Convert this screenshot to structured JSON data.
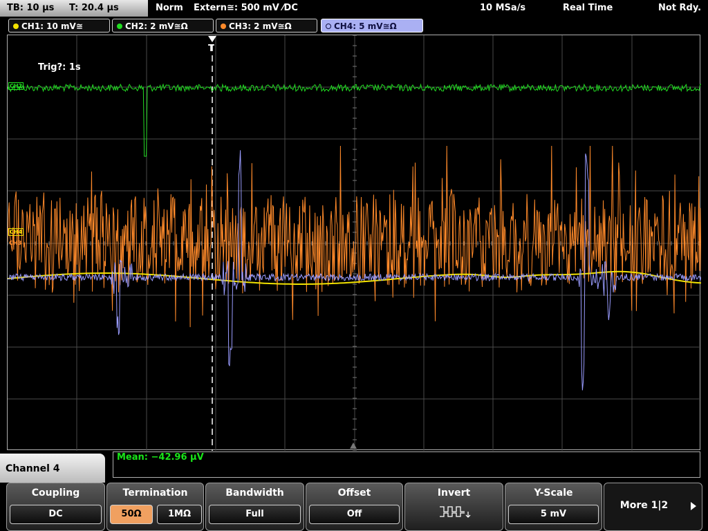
{
  "top": {
    "timebase": "TB: 10 µs",
    "trigger_time": "T: 20.4 µs",
    "trigger_mode": "Norm",
    "trigger_source": "Extern≅: 500 mV ⁄DC",
    "sample_rate": "10 MSa/s",
    "acq_mode": "Real Time",
    "status": "Not Rdy."
  },
  "channels": [
    {
      "label": "CH1: 10 mV≅",
      "color": "#f2e200",
      "active": false
    },
    {
      "label": "CH2: 2 mV≅Ω",
      "color": "#22dd22",
      "active": false
    },
    {
      "label": "CH3: 2 mV≅Ω",
      "color": "#ff8a2a",
      "active": false
    },
    {
      "label": "CH4: 5 mV≅Ω",
      "color": "#9a9cff",
      "active": true
    }
  ],
  "trigger_info": "Trig?: 1s",
  "measurement": "Mean: −42.96 µV",
  "menu": {
    "title": "Channel 4",
    "coupling": {
      "title": "Coupling",
      "value": "DC"
    },
    "termination": {
      "title": "Termination",
      "options": [
        "50Ω",
        "1MΩ"
      ],
      "selected": "50Ω"
    },
    "bandwidth": {
      "title": "Bandwidth",
      "value": "Full"
    },
    "offset": {
      "title": "Offset",
      "value": "Off"
    },
    "invert": {
      "title": "Invert",
      "icon": "invert-square-wave-icon"
    },
    "yscale": {
      "title": "Y-Scale",
      "value": "5 mV"
    },
    "more": {
      "label": "More 1|2",
      "icon": "arrow-right-icon"
    }
  },
  "markers": {
    "ch2": "CH2",
    "ch3": "CH3",
    "ch4": "CH4",
    "trigger": "T"
  },
  "colors": {
    "ch1": "#f2e200",
    "ch2": "#22dd22",
    "ch3": "#ff8a2a",
    "ch4": "#9a9cff",
    "grid": "#4a4a4a",
    "measure": "#19e619"
  }
}
